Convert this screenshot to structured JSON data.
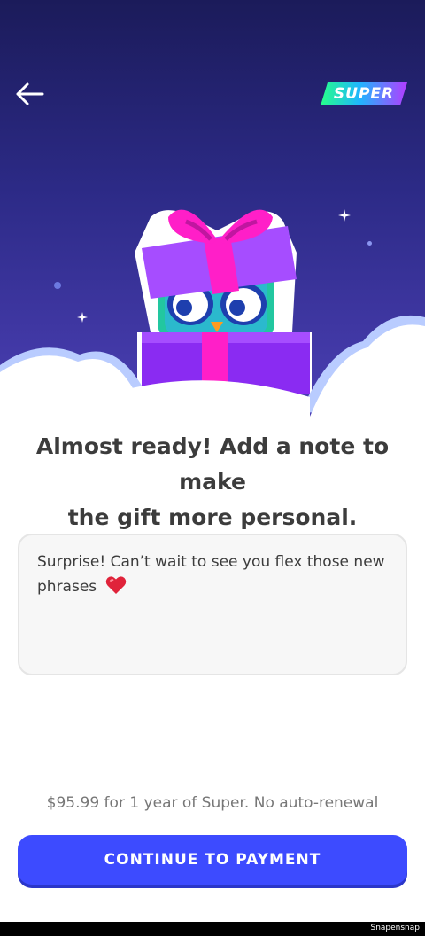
{
  "header": {
    "back_icon": "arrow-left-icon",
    "badge_text": "SUPER"
  },
  "hero": {
    "illustration": "gift-box-with-mascot"
  },
  "content": {
    "headline_line1": "Almost ready! Add a note to make",
    "headline_line2": "the gift more personal.",
    "note": {
      "value_line1": "Surprise! Can’t wait to see you flex those new",
      "value_line2": "phrases",
      "emoji": "heart-icon"
    },
    "price_info": "$95.99 for 1 year of Super. No auto-renewal",
    "cta_label": "CONTINUE TO PAYMENT"
  },
  "footer": {
    "watermark": "Snapensnap"
  },
  "colors": {
    "cta": "#3D4BFF",
    "hero_top": "#1B1B5A",
    "hero_bottom": "#4B3FB4",
    "gift_pink": "#FF1FC8",
    "gift_purple": "#8A2BF2"
  }
}
